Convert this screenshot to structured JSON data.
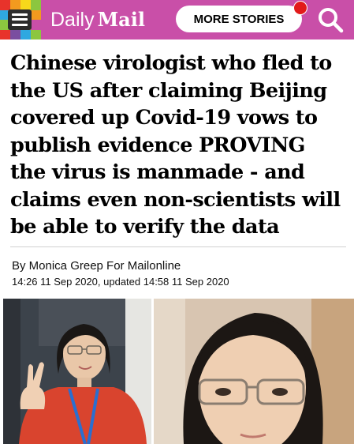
{
  "header": {
    "logo_daily": "Daily",
    "logo_mail": "Mail",
    "more_stories_label": "MORE STORIES",
    "brand_color": "#c94fa8",
    "notification_color": "#e21a1a",
    "menu_icon": "hamburger-menu-icon",
    "search_icon": "search-icon"
  },
  "article": {
    "headline": "Chinese virologist who fled to the US after claiming Beijing covered up Covid-19 vows to publish evidence PROVING the virus is manmade - and claims even non-scientists will be able to verify the data",
    "byline": "By Monica Greep For Mailonline",
    "dateline": "14:26 11 Sep 2020, updated 14:58 11 Sep 2020"
  },
  "photos": {
    "left_photo": "photo-woman-victory-sign",
    "right_photo": "photo-woman-glasses-closeup"
  }
}
